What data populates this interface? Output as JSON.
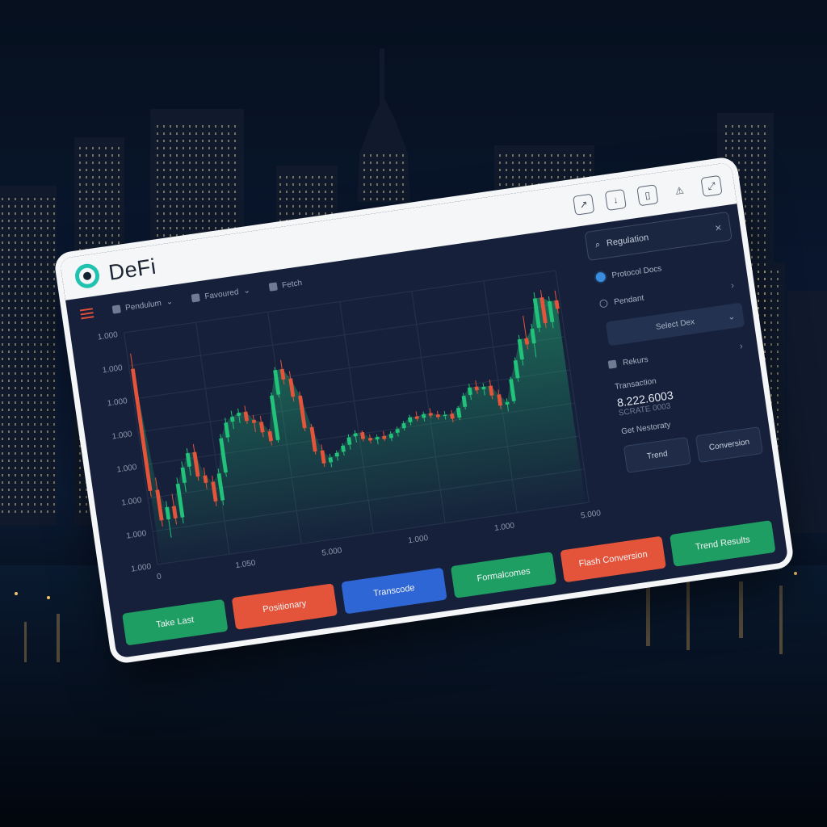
{
  "app": {
    "title": "DeFi"
  },
  "titlebar_icons": [
    "share-icon",
    "download-icon",
    "bookmark-icon",
    "alert-icon",
    "expand-icon"
  ],
  "toolbar": {
    "items": [
      {
        "label": "Pendulum",
        "icon": "chart-type-icon"
      },
      {
        "label": "Favoured",
        "icon": "indicator-icon"
      },
      {
        "label": "Fetch",
        "icon": "camera-icon"
      }
    ]
  },
  "chart_data": {
    "type": "candlestick",
    "y_tick_labels": [
      "1.000",
      "1.000",
      "1.000",
      "1.000",
      "1.000",
      "1.000",
      "1.000",
      "1.000"
    ],
    "x_tick_labels": [
      "0",
      "1.050",
      "5.000",
      "1.000",
      "1.000",
      "5.000"
    ],
    "candles": [
      {
        "o": 580,
        "h": 605,
        "l": 370,
        "c": 380
      },
      {
        "o": 380,
        "h": 400,
        "l": 320,
        "c": 330
      },
      {
        "o": 330,
        "h": 360,
        "l": 300,
        "c": 350
      },
      {
        "o": 350,
        "h": 370,
        "l": 320,
        "c": 330
      },
      {
        "o": 330,
        "h": 395,
        "l": 320,
        "c": 385
      },
      {
        "o": 385,
        "h": 420,
        "l": 370,
        "c": 410
      },
      {
        "o": 410,
        "h": 440,
        "l": 395,
        "c": 432
      },
      {
        "o": 432,
        "h": 445,
        "l": 385,
        "c": 392
      },
      {
        "o": 392,
        "h": 405,
        "l": 370,
        "c": 380
      },
      {
        "o": 380,
        "h": 390,
        "l": 340,
        "c": 348
      },
      {
        "o": 348,
        "h": 400,
        "l": 340,
        "c": 392
      },
      {
        "o": 392,
        "h": 455,
        "l": 385,
        "c": 448
      },
      {
        "o": 448,
        "h": 480,
        "l": 440,
        "c": 472
      },
      {
        "o": 472,
        "h": 490,
        "l": 460,
        "c": 480
      },
      {
        "o": 480,
        "h": 492,
        "l": 468,
        "c": 485
      },
      {
        "o": 485,
        "h": 495,
        "l": 465,
        "c": 470
      },
      {
        "o": 470,
        "h": 478,
        "l": 450,
        "c": 465
      },
      {
        "o": 465,
        "h": 475,
        "l": 440,
        "c": 448
      },
      {
        "o": 448,
        "h": 452,
        "l": 425,
        "c": 432
      },
      {
        "o": 432,
        "h": 510,
        "l": 428,
        "c": 505
      },
      {
        "o": 505,
        "h": 550,
        "l": 500,
        "c": 545
      },
      {
        "o": 545,
        "h": 560,
        "l": 520,
        "c": 528
      },
      {
        "o": 528,
        "h": 540,
        "l": 490,
        "c": 498
      },
      {
        "o": 498,
        "h": 505,
        "l": 440,
        "c": 445
      },
      {
        "o": 445,
        "h": 450,
        "l": 400,
        "c": 405
      },
      {
        "o": 405,
        "h": 415,
        "l": 378,
        "c": 384
      },
      {
        "o": 384,
        "h": 398,
        "l": 376,
        "c": 392
      },
      {
        "o": 392,
        "h": 402,
        "l": 385,
        "c": 398
      },
      {
        "o": 398,
        "h": 412,
        "l": 392,
        "c": 408
      },
      {
        "o": 408,
        "h": 425,
        "l": 400,
        "c": 420
      },
      {
        "o": 420,
        "h": 430,
        "l": 410,
        "c": 425
      },
      {
        "o": 425,
        "h": 428,
        "l": 410,
        "c": 414
      },
      {
        "o": 414,
        "h": 420,
        "l": 405,
        "c": 410
      },
      {
        "o": 410,
        "h": 418,
        "l": 402,
        "c": 414
      },
      {
        "o": 414,
        "h": 422,
        "l": 406,
        "c": 409
      },
      {
        "o": 409,
        "h": 420,
        "l": 404,
        "c": 416
      },
      {
        "o": 416,
        "h": 426,
        "l": 410,
        "c": 422
      },
      {
        "o": 422,
        "h": 434,
        "l": 418,
        "c": 430
      },
      {
        "o": 430,
        "h": 442,
        "l": 425,
        "c": 438
      },
      {
        "o": 438,
        "h": 446,
        "l": 430,
        "c": 434
      },
      {
        "o": 434,
        "h": 444,
        "l": 428,
        "c": 440
      },
      {
        "o": 440,
        "h": 448,
        "l": 432,
        "c": 436
      },
      {
        "o": 436,
        "h": 442,
        "l": 428,
        "c": 432
      },
      {
        "o": 432,
        "h": 440,
        "l": 426,
        "c": 434
      },
      {
        "o": 434,
        "h": 440,
        "l": 420,
        "c": 426
      },
      {
        "o": 426,
        "h": 445,
        "l": 422,
        "c": 442
      },
      {
        "o": 442,
        "h": 465,
        "l": 438,
        "c": 460
      },
      {
        "o": 460,
        "h": 478,
        "l": 452,
        "c": 472
      },
      {
        "o": 472,
        "h": 482,
        "l": 460,
        "c": 466
      },
      {
        "o": 466,
        "h": 476,
        "l": 456,
        "c": 470
      },
      {
        "o": 470,
        "h": 480,
        "l": 448,
        "c": 454
      },
      {
        "o": 454,
        "h": 462,
        "l": 430,
        "c": 436
      },
      {
        "o": 436,
        "h": 446,
        "l": 425,
        "c": 440
      },
      {
        "o": 440,
        "h": 480,
        "l": 436,
        "c": 476
      },
      {
        "o": 476,
        "h": 510,
        "l": 470,
        "c": 505
      },
      {
        "o": 505,
        "h": 545,
        "l": 495,
        "c": 538
      },
      {
        "o": 538,
        "h": 575,
        "l": 520,
        "c": 528
      },
      {
        "o": 528,
        "h": 560,
        "l": 505,
        "c": 552
      },
      {
        "o": 552,
        "h": 610,
        "l": 545,
        "c": 600
      },
      {
        "o": 600,
        "h": 612,
        "l": 550,
        "c": 558
      },
      {
        "o": 558,
        "h": 600,
        "l": 548,
        "c": 592
      },
      {
        "o": 592,
        "h": 608,
        "l": 570,
        "c": 578
      }
    ],
    "ylim": [
      260,
      640
    ]
  },
  "sidebar": {
    "search": {
      "value": "Regulation"
    },
    "rows": [
      {
        "label": "Protocol Docs",
        "icon": "protocol-icon"
      },
      {
        "label": "Pendant",
        "icon": "circle-icon"
      },
      {
        "label": "Rekurs",
        "icon": "doc-icon"
      }
    ],
    "dropdown": {
      "label": "Select Dex"
    },
    "stat": {
      "label": "Transaction",
      "value": "8.222.6003",
      "sub": "SCRATE 0003"
    },
    "section_label": "Get Nestoraty",
    "buttons": [
      {
        "label": "Trend"
      },
      {
        "label": "Conversion"
      }
    ]
  },
  "actions": [
    {
      "label": "Take Last",
      "color": "green"
    },
    {
      "label": "Positionary",
      "color": "red"
    },
    {
      "label": "Transcode",
      "color": "blue"
    },
    {
      "label": "Formalcomes",
      "color": "green"
    },
    {
      "label": "Flash Conversion",
      "color": "red"
    },
    {
      "label": "Trend Results",
      "color": "green"
    }
  ],
  "colors": {
    "up": "#22c27a",
    "down": "#e4543a",
    "accent": "#21c3b0",
    "panel": "#16203a"
  }
}
